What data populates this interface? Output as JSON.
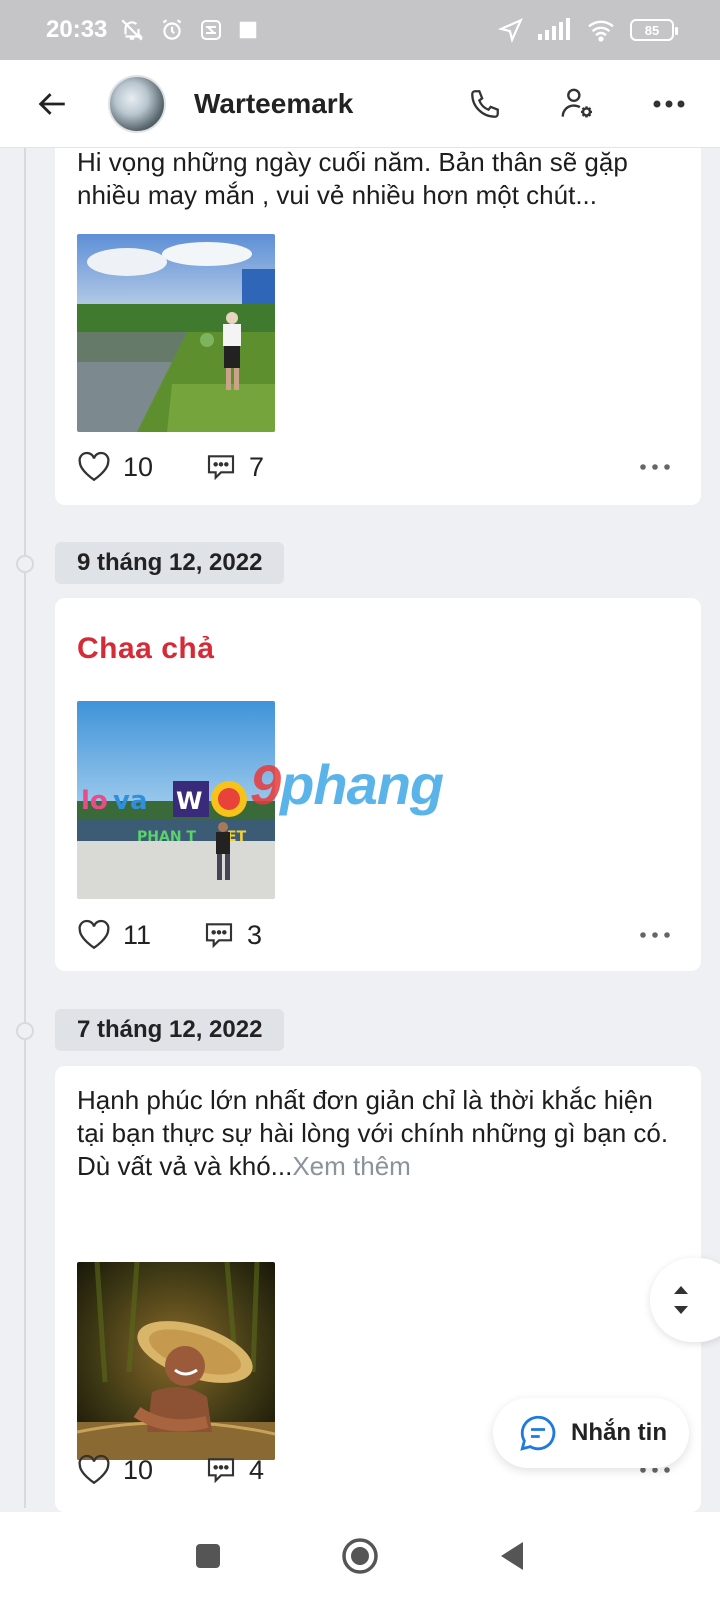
{
  "status_bar": {
    "time": "20:33",
    "battery": "85"
  },
  "header": {
    "profile_name": "Warteemark"
  },
  "posts": [
    {
      "text": "Hi vọng những ngày cuối năm. Bản thân sẽ gặp nhiều may mắn , vui vẻ nhiều hơn một chút...",
      "likes": "10",
      "comments": "7"
    },
    {
      "date": "9 tháng 12, 2022",
      "title": "Chaa chả",
      "likes": "11",
      "comments": "3"
    },
    {
      "date": "7 tháng 12, 2022",
      "text_line1": "Hạnh phúc lớn nhất đơn giản chỉ là thời khắc hiện tại bạn thực sự hài lòng với chính những gì bạn có.",
      "text_line2": "Dù vất vả và khó...",
      "see_more": "Xem thêm",
      "likes": "10",
      "comments": "4"
    }
  ],
  "watermark": {
    "first": "9",
    "rest": "phang"
  },
  "message_button": {
    "label": "Nhắn tin"
  },
  "colors": {
    "title_red": "#d62a37",
    "accent_blue": "#1f7ae0",
    "background": "#eef0f3"
  }
}
